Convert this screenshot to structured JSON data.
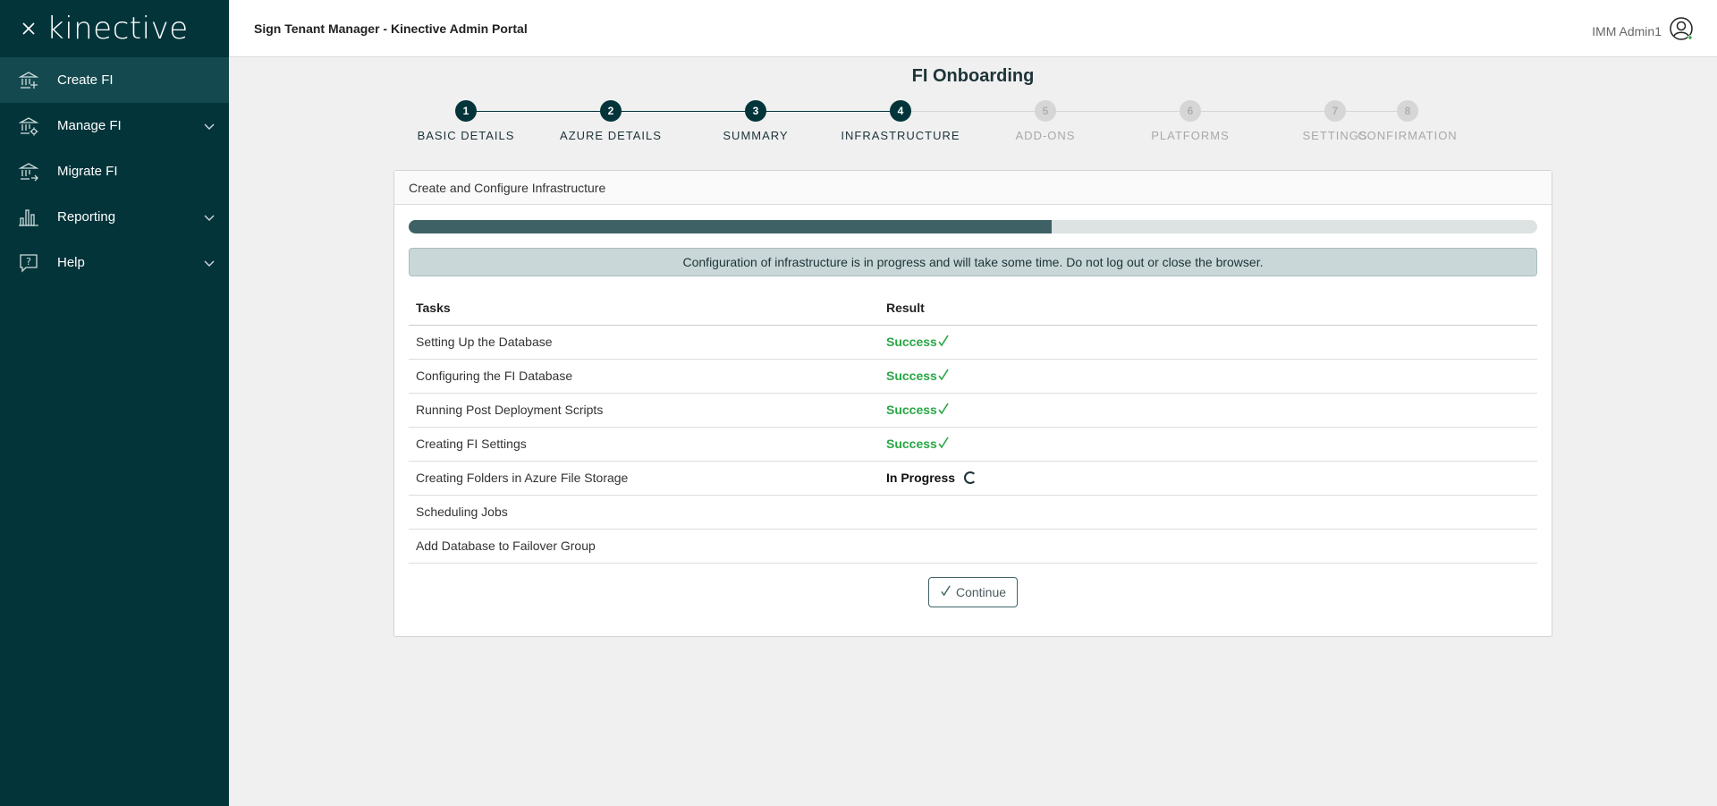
{
  "brand": {
    "logo_text": "kinective"
  },
  "sidebar": {
    "items": [
      {
        "label": "Create FI",
        "icon": "bank-add-icon",
        "active": true
      },
      {
        "label": "Manage FI",
        "icon": "bank-settings-icon",
        "expandable": true
      },
      {
        "label": "Migrate FI",
        "icon": "bank-migrate-icon"
      },
      {
        "label": "Reporting",
        "icon": "bar-chart-icon",
        "expandable": true
      },
      {
        "label": "Help",
        "icon": "help-bubble-icon",
        "expandable": true
      }
    ]
  },
  "header": {
    "title": "Sign Tenant Manager - Kinective Admin Portal",
    "user": "IMM Admin1"
  },
  "page": {
    "title": "FI Onboarding"
  },
  "stepper": {
    "steps": [
      {
        "number": "1",
        "label": "BASIC DETAILS",
        "state": "done"
      },
      {
        "number": "2",
        "label": "AZURE DETAILS",
        "state": "done"
      },
      {
        "number": "3",
        "label": "SUMMARY",
        "state": "done"
      },
      {
        "number": "4",
        "label": "INFRASTRUCTURE",
        "state": "current"
      },
      {
        "number": "5",
        "label": "ADD-ONS",
        "state": "todo"
      },
      {
        "number": "6",
        "label": "PLATFORMS",
        "state": "todo"
      },
      {
        "number": "7",
        "label": "SETTINGS",
        "state": "todo"
      },
      {
        "number": "8",
        "label": "CONFIRMATION",
        "state": "todo"
      }
    ]
  },
  "card": {
    "title": "Create and Configure Infrastructure",
    "progress_percent": 57,
    "alert": "Configuration of infrastructure is in progress and will take some time. Do not log out or close the browser.",
    "table": {
      "headers": [
        "Tasks",
        "Result"
      ],
      "rows": [
        {
          "task": "Setting Up the Database",
          "result": "Success",
          "status": "success"
        },
        {
          "task": "Configuring the FI Database",
          "result": "Success",
          "status": "success"
        },
        {
          "task": "Running Post Deployment Scripts",
          "result": "Success",
          "status": "success"
        },
        {
          "task": "Creating FI Settings",
          "result": "Success",
          "status": "success"
        },
        {
          "task": "Creating Folders in Azure File Storage",
          "result": "In Progress",
          "status": "progress"
        },
        {
          "task": "Scheduling Jobs",
          "result": "",
          "status": "pending"
        },
        {
          "task": "Add Database to Failover Group",
          "result": "",
          "status": "pending"
        }
      ]
    },
    "continue_label": "Continue"
  },
  "colors": {
    "sidebar_bg": "#02343a",
    "sidebar_active": "#144a4f",
    "success": "#28a745",
    "accent": "#3e6165"
  }
}
